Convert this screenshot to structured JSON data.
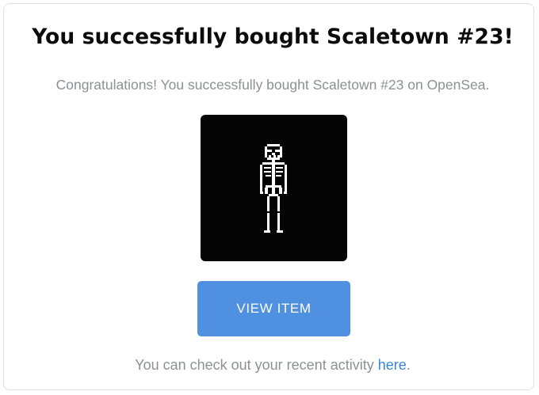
{
  "dialog": {
    "title": "You successfully bought Scaletown #23!",
    "subtitle": "Congratulations! You successfully bought Scaletown #23 on OpenSea.",
    "item_image": {
      "icon": "pixel-skeleton",
      "background_color": "#050505",
      "figure_color": "#ffffff"
    },
    "view_button_label": "VIEW ITEM",
    "footer_text": "You can check out your recent activity ",
    "footer_link_label": "here",
    "footer_end": "."
  },
  "colors": {
    "accent": "#4f90e0",
    "link": "#3c86d6",
    "muted_text": "#8d9095",
    "title_text": "#0b0b0b"
  }
}
